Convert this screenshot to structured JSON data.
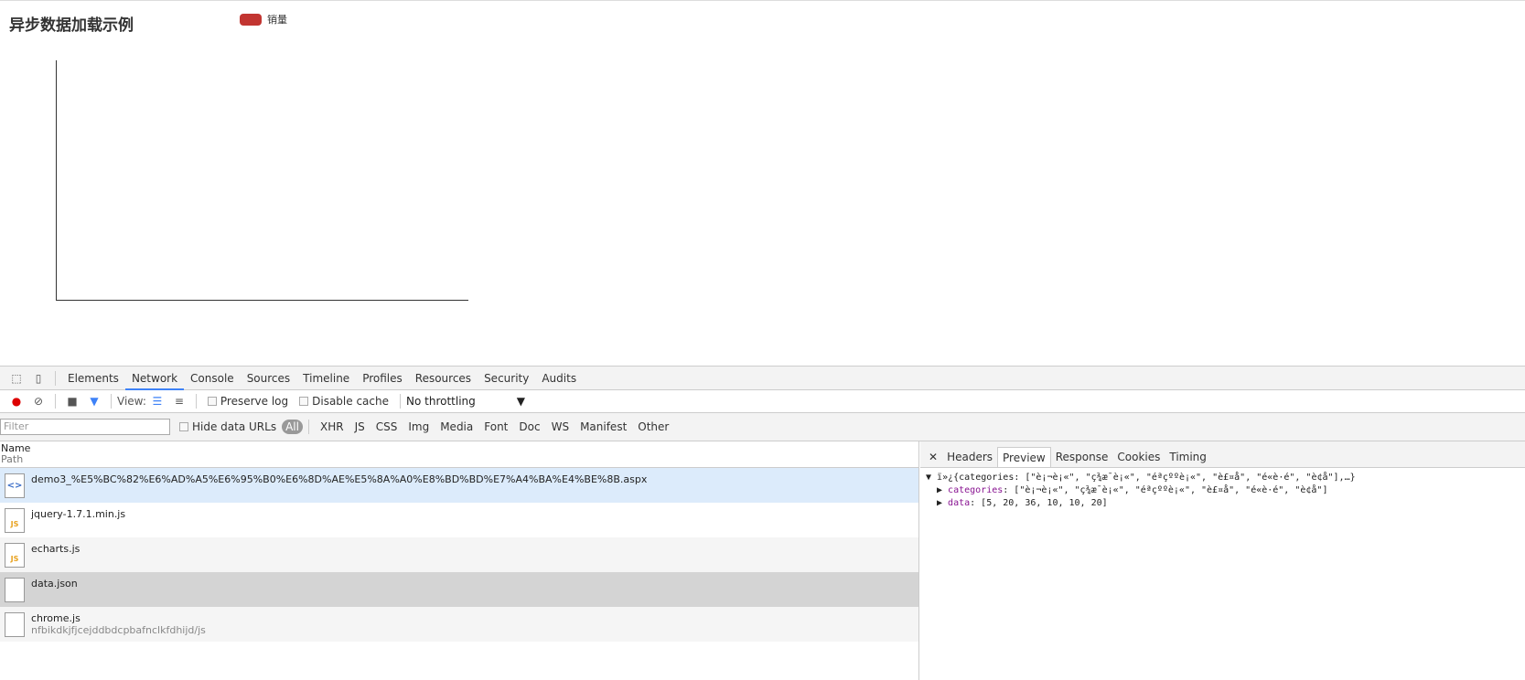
{
  "page": {
    "title": "异步数据加载示例",
    "legend": "销量",
    "legend_color": "#c23531"
  },
  "devtools": {
    "tabs": [
      "Elements",
      "Network",
      "Console",
      "Sources",
      "Timeline",
      "Profiles",
      "Resources",
      "Security",
      "Audits"
    ],
    "active_tab": "Network",
    "toolbar": {
      "view_label": "View:",
      "preserve_log": "Preserve log",
      "disable_cache": "Disable cache",
      "throttling": "No throttling"
    },
    "filter": {
      "placeholder": "Filter",
      "hide_data_urls": "Hide data URLs",
      "types": [
        "All",
        "XHR",
        "JS",
        "CSS",
        "Img",
        "Media",
        "Font",
        "Doc",
        "WS",
        "Manifest",
        "Other"
      ]
    },
    "columns": {
      "name": "Name",
      "path": "Path"
    },
    "requests": [
      {
        "name": "demo3_%E5%BC%82%E6%AD%A5%E6%95%B0%E6%8D%AE%E5%8A%A0%E8%BD%BD%E7%A4%BA%E4%BE%8B.aspx",
        "path": "",
        "icon": "doc"
      },
      {
        "name": "jquery-1.7.1.min.js",
        "path": "",
        "icon": "js"
      },
      {
        "name": "echarts.js",
        "path": "",
        "icon": "js"
      },
      {
        "name": "data.json",
        "path": "",
        "icon": "blank"
      },
      {
        "name": "chrome.js",
        "path": "nfbikdkjfjcejddbdcpbafnclkfdhijd/js",
        "icon": "blank"
      }
    ],
    "detail_tabs": [
      "Headers",
      "Preview",
      "Response",
      "Cookies",
      "Timing"
    ],
    "preview": {
      "line1": "ï»¿{categories: [\"è¡¬è¡«\", \"ç¾æ¯è¡«\", \"éªçººè¡«\", \"è£¤å\", \"é«è·é\", \"è¢å\"],…}",
      "categories_key": "categories",
      "categories_val": ": [\"è¡¬è¡«\", \"ç¾æ¯è¡«\", \"éªçººè¡«\", \"è£¤å\", \"é«è·é\", \"è¢å\"]",
      "data_key": "data",
      "data_val": ": [5, 20, 36, 10, 10, 20]"
    }
  }
}
